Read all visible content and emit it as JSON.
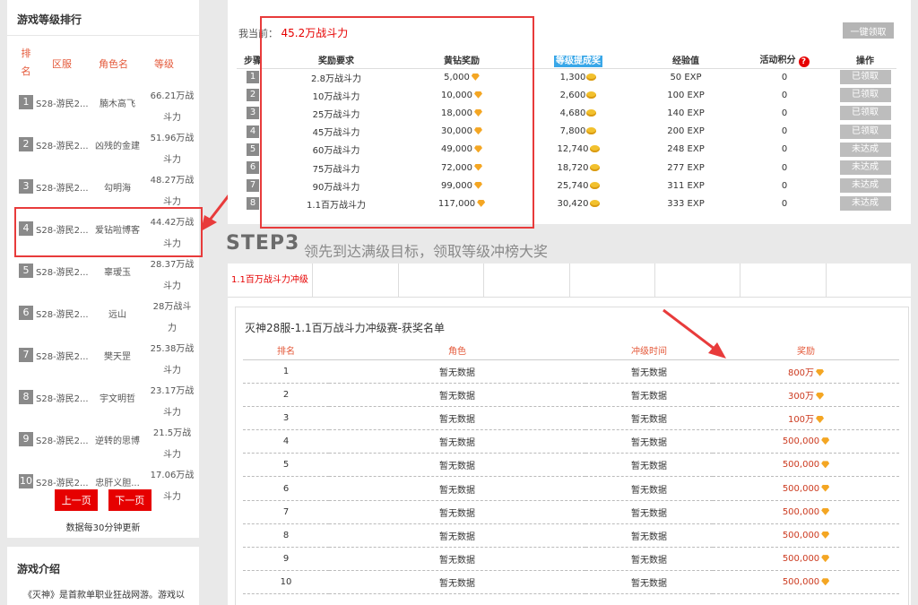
{
  "sidebar": {
    "title": "游戏等级排行",
    "headers": {
      "rank": "排名",
      "server": "区服",
      "role": "角色名",
      "level": "等级"
    },
    "rows": [
      {
        "num": "1",
        "server": "S28-游民2...",
        "role": "腩木高飞",
        "level": "66.21万战斗力"
      },
      {
        "num": "2",
        "server": "S28-游民2...",
        "role": "凶残的金建",
        "level": "51.96万战斗力"
      },
      {
        "num": "3",
        "server": "S28-游民2...",
        "role": "勾明海",
        "level": "48.27万战斗力"
      },
      {
        "num": "4",
        "server": "S28-游民2...",
        "role": "爱钻啦博客",
        "level": "44.42万战斗力"
      },
      {
        "num": "5",
        "server": "S28-游民2...",
        "role": "辜瑷玉",
        "level": "28.37万战斗力"
      },
      {
        "num": "6",
        "server": "S28-游民2...",
        "role": "远山",
        "level": "28万战斗力"
      },
      {
        "num": "7",
        "server": "S28-游民2...",
        "role": "樊天罡",
        "level": "25.38万战斗力"
      },
      {
        "num": "8",
        "server": "S28-游民2...",
        "role": "宇文明哲",
        "level": "23.17万战斗力"
      },
      {
        "num": "9",
        "server": "S28-游民2...",
        "role": "逆转的思博",
        "level": "21.5万战斗力"
      },
      {
        "num": "10",
        "server": "S28-游民2...",
        "role": "忠肝义胆...",
        "level": "17.06万战斗力"
      }
    ],
    "highlight_rank": "4",
    "prev_label": "上一页",
    "next_label": "下一页",
    "update_note": "数据每30分钟更新"
  },
  "intro": {
    "title": "游戏介绍",
    "text": "《灭神》是首款单职业狂战网游。游戏以"
  },
  "reward": {
    "current_label": "我当前：",
    "current_value": "45.2万战斗力",
    "claim_all": "一键领取",
    "headers": [
      "步骤",
      "奖励要求",
      "黄钻奖励",
      "等级提成奖",
      "经验值",
      "活动积分",
      "操作"
    ],
    "rows": [
      {
        "step": "1",
        "req": "2.8万战斗力",
        "diamond": "5,000",
        "coin": "1,300",
        "exp": "50 EXP",
        "points": "0",
        "op": "已领取"
      },
      {
        "step": "2",
        "req": "10万战斗力",
        "diamond": "10,000",
        "coin": "2,600",
        "exp": "100 EXP",
        "points": "0",
        "op": "已领取"
      },
      {
        "step": "3",
        "req": "25万战斗力",
        "diamond": "18,000",
        "coin": "4,680",
        "exp": "140 EXP",
        "points": "0",
        "op": "已领取"
      },
      {
        "step": "4",
        "req": "45万战斗力",
        "diamond": "30,000",
        "coin": "7,800",
        "exp": "200 EXP",
        "points": "0",
        "op": "已领取"
      },
      {
        "step": "5",
        "req": "60万战斗力",
        "diamond": "49,000",
        "coin": "12,740",
        "exp": "248 EXP",
        "points": "0",
        "op": "未达成"
      },
      {
        "step": "6",
        "req": "75万战斗力",
        "diamond": "72,000",
        "coin": "18,720",
        "exp": "277 EXP",
        "points": "0",
        "op": "未达成"
      },
      {
        "step": "7",
        "req": "90万战斗力",
        "diamond": "99,000",
        "coin": "25,740",
        "exp": "311 EXP",
        "points": "0",
        "op": "未达成"
      },
      {
        "step": "8",
        "req": "1.1百万战斗力",
        "diamond": "117,000",
        "coin": "30,420",
        "exp": "333 EXP",
        "points": "0",
        "op": "未达成"
      }
    ]
  },
  "step3": {
    "title": "STEP3",
    "subtitle": "领先到达满级目标，领取等级冲榜大奖",
    "tabs": [
      "1.1百万战斗力冲级",
      "",
      "",
      "",
      "",
      "",
      "",
      ""
    ],
    "winners_title": "灭神28服-1.1百万战斗力冲级赛-获奖名单",
    "headers": [
      "排名",
      "角色",
      "冲级时间",
      "奖励"
    ],
    "rows": [
      {
        "rank": "1",
        "role": "暂无数据",
        "time": "暂无数据",
        "prize": "800万",
        "icon": "diamond"
      },
      {
        "rank": "2",
        "role": "暂无数据",
        "time": "暂无数据",
        "prize": "300万",
        "icon": "diamond"
      },
      {
        "rank": "3",
        "role": "暂无数据",
        "time": "暂无数据",
        "prize": "100万",
        "icon": "diamond"
      },
      {
        "rank": "4",
        "role": "暂无数据",
        "time": "暂无数据",
        "prize": "500,000",
        "icon": "diamond"
      },
      {
        "rank": "5",
        "role": "暂无数据",
        "time": "暂无数据",
        "prize": "500,000",
        "icon": "diamond"
      },
      {
        "rank": "6",
        "role": "暂无数据",
        "time": "暂无数据",
        "prize": "500,000",
        "icon": "diamond"
      },
      {
        "rank": "7",
        "role": "暂无数据",
        "time": "暂无数据",
        "prize": "500,000",
        "icon": "diamond"
      },
      {
        "rank": "8",
        "role": "暂无数据",
        "time": "暂无数据",
        "prize": "500,000",
        "icon": "diamond"
      },
      {
        "rank": "9",
        "role": "暂无数据",
        "time": "暂无数据",
        "prize": "500,000",
        "icon": "diamond"
      },
      {
        "rank": "10",
        "role": "暂无数据",
        "time": "暂无数据",
        "prize": "500,000",
        "icon": "diamond"
      }
    ]
  },
  "colors": {
    "accent_red": "#e60000",
    "annotation_red": "#e83b3b",
    "highlight_blue": "#39a7e8",
    "step_gray": "#8a8a8a"
  }
}
